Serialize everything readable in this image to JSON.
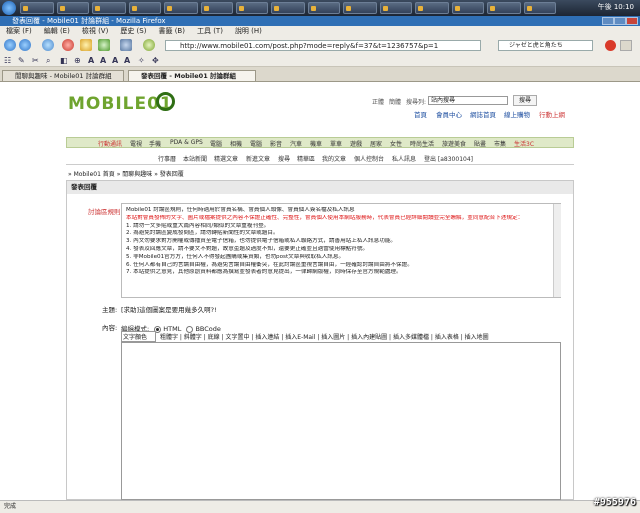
{
  "window": {
    "title": "發表回覆 - Mobile01 討論群組 - Mozilla Firefox",
    "clock": "午後 10:10"
  },
  "menubar": [
    "檔案 (F)",
    "編輯 (E)",
    "檢視 (V)",
    "歷史 (S)",
    "書籤 (B)",
    "工具 (T)",
    "說明 (H)"
  ],
  "address": {
    "url": "http://www.mobile01.com/post.php?mode=reply&f=37&t=1236757&p=1",
    "search_placeholder": "ジャゼと虎と角たち"
  },
  "tabs": [
    "閒聊與趣味 - Mobile01 討論群組",
    "發表回覆 - Mobile01 討論群組"
  ],
  "header": {
    "logo": "MOBILE01",
    "top_links": [
      "正體",
      "簡體",
      "搜尋列:"
    ],
    "site_search": "站內搜尋",
    "search_button": "搜尋",
    "main_links": [
      "首頁",
      "會員中心",
      "網誌首頁",
      "線上購物",
      "行動上網"
    ]
  },
  "categories": [
    "行動通訊",
    "電視",
    "手機",
    "PDA & GPS",
    "電腦",
    "相機",
    "電腦",
    "影音",
    "汽車",
    "機車",
    "單車",
    "遊戲",
    "居家",
    "女性",
    "時尚生活",
    "旅遊美食",
    "貼畫",
    "市集",
    "生活3C"
  ],
  "subnav": [
    "行事曆",
    "本站新聞",
    "精選文章",
    "新進文章",
    "搜尋",
    "精華區",
    "我的文章",
    "個人控制台",
    "私人訊息",
    "登出 [a8300104]"
  ],
  "breadcrumb": "» Mobile01 首頁 » 閒聊與趣味 » 發表回覆",
  "panel": {
    "heading": "發表回覆",
    "rules_label": "討論區規則:",
    "rules": [
      {
        "text": "Mobile01 討論區規則，任何時適用於會員名稱、會員個人頭像、會員個人簽名檔及私人訊息",
        "red": false
      },
      {
        "text": "",
        "red": false
      },
      {
        "text": "本站對會員發佈的文字、圖片或檔案提供之內容不保證正確性、完整性，會員個人使用本網站服務時，代表會員已經詳細閱讀並完全瞭解，並同意配合下述規定：",
        "red": true
      },
      {
        "text": "",
        "red": false
      },
      {
        "text": "1. 請勿一文多貼或重大篇內容相同/類似的文章重複刊登。",
        "red": false
      },
      {
        "text": "2. 為避免討論區變成發問區，請勿轉貼新聞性的文章或題目。",
        "red": false
      },
      {
        "text": "3. 內文勿要求對方開權或傳播資至電子信箱，也勿提供電子信箱或私人聯絡方式，請善用站上私人訊息功能。",
        "red": false
      },
      {
        "text": "4. 發表及回應文章，請不要文不對題，故意歪題及過度不知，還要更正確並且適當使用標點符號。",
        "red": false
      },
      {
        "text": "5. 非Mobile01官方方，任何人不得發起團購或集資類，也勿post文章與收取私人訊息。",
        "red": false
      },
      {
        "text": "6. 任何人都有自己的言論自由權，為避免言論自由權衝突，在此討論區重視言論自由，一經確認討論自由將不保證。",
        "red": false
      },
      {
        "text": "7. 本站提供之意見，其他原創資料都應為撰寫並發表者的意見提出，一律歸網版權，同時保存至官方規範處理。",
        "red": false
      }
    ],
    "subject_label": "主題:",
    "subject_value": "[求助]這個圖案是要用幾多久啊?!",
    "content_label": "內容:",
    "mode_label": "編緝模式:",
    "mode_options": [
      "HTML",
      "BBCode"
    ],
    "font_select": "文字顏色",
    "toolbar": [
      "粗體字",
      "斜體字",
      "底線",
      "文字置中",
      "插入連結",
      "插入E-Mail",
      "插入圖片",
      "插入內建貼圖",
      "插入多媒體檔",
      "插入表格",
      "插入地圖"
    ]
  },
  "status": "完成",
  "watermark": "#955976"
}
